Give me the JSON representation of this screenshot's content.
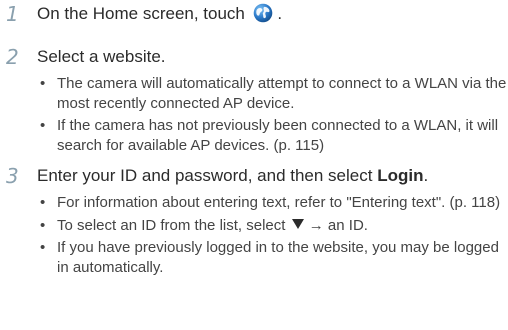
{
  "steps": [
    {
      "number": "1",
      "text_before": "On the Home screen, touch",
      "icon": "globe-icon",
      "text_after": "."
    },
    {
      "number": "2",
      "text": "Select a website.",
      "bullets": [
        "The camera will automatically attempt to connect to a WLAN via the most recently connected AP device.",
        "If the camera has not previously been connected to a WLAN, it will search for available AP devices. (p. 115)"
      ]
    },
    {
      "number": "3",
      "text_before": "Enter your ID and password, and then select",
      "bold": "Login",
      "text_after": ".",
      "bullets": {
        "b1": "For information about entering text, refer to \"Entering text\". (p. 118)",
        "b2_before": "To select an ID from the list, select",
        "b2_icon": "dropdown-triangle-icon",
        "b2_after": "→ an ID.",
        "b3": "If you have previously logged in to the website, you may be logged in automatically."
      }
    }
  ],
  "colors": {
    "step_number": "#8aa0ae",
    "text": "#2b2b2b",
    "bullet_text": "#444444",
    "globe_blue": "#2a78c8"
  }
}
